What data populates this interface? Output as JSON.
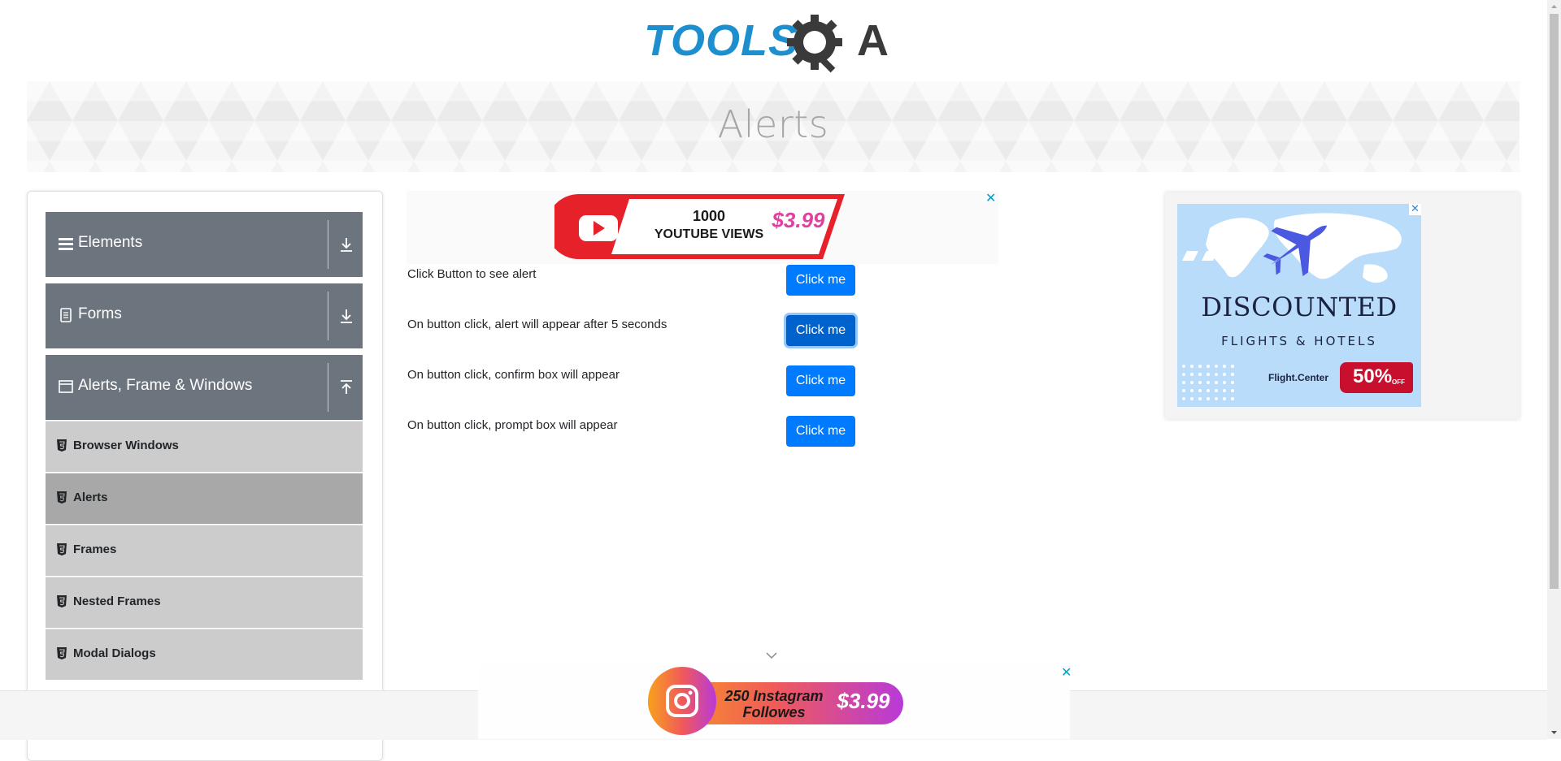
{
  "header": {
    "logo_text_a": "TOOLS",
    "logo_text_b": "A",
    "logo_color": "#1d8fcf"
  },
  "banner": {
    "title": "Alerts"
  },
  "sidebar": {
    "groups": [
      {
        "label": "Elements",
        "icon": "hamburger-icon",
        "arrow": "download-arrow-icon"
      },
      {
        "label": "Forms",
        "icon": "document-icon",
        "arrow": "download-arrow-icon"
      },
      {
        "label": "Alerts, Frame & Windows",
        "icon": "window-icon",
        "arrow": "upload-arrow-icon"
      }
    ],
    "items": [
      {
        "label": "Browser Windows"
      },
      {
        "label": "Alerts",
        "active": true
      },
      {
        "label": "Frames"
      },
      {
        "label": "Nested Frames"
      },
      {
        "label": "Modal Dialogs"
      }
    ]
  },
  "ads": {
    "top": {
      "line1": "1000",
      "line2": "YOUTUBE VIEWS",
      "price": "$3.99",
      "close": "✕"
    },
    "right": {
      "title": "DISCOUNTED",
      "subtitle": "FLIGHTS & HOTELS",
      "brand": "Flight.Center",
      "percent": "50%",
      "off": "OFF",
      "close": "✕"
    },
    "bottom": {
      "line1": "250 Instagram",
      "line2": "Followes",
      "price": "$3.99",
      "close": "✕"
    }
  },
  "alerts": [
    {
      "text": "Click Button to see alert",
      "button": "Click me"
    },
    {
      "text": "On button click, alert will appear after 5 seconds",
      "button": "Click me",
      "focused": true
    },
    {
      "text": "On button click, confirm box will appear",
      "button": "Click me"
    },
    {
      "text": "On button click, prompt box will appear",
      "button": "Click me"
    }
  ],
  "colors": {
    "primary_button": "#007bff",
    "sidebar_group": "#6c757d",
    "sidebar_item": "#cccccc",
    "sidebar_item_active": "#a8a8a8"
  }
}
